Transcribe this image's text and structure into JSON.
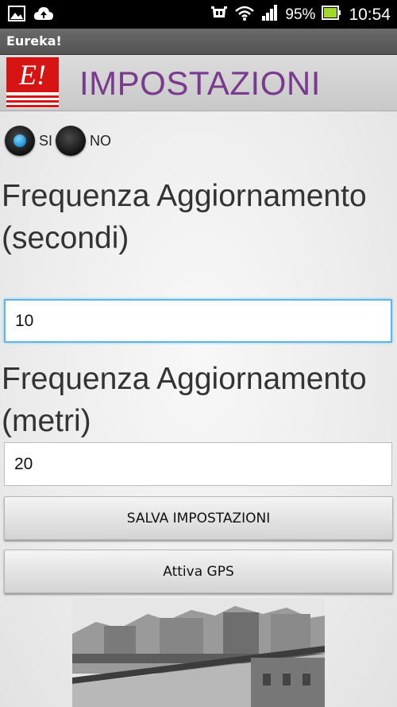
{
  "status_bar": {
    "battery_text": "95%",
    "time": "10:54",
    "icons": [
      "image-icon",
      "cloud-upload-icon",
      "android-icon",
      "wifi-icon",
      "signal-icon",
      "battery-icon"
    ]
  },
  "app": {
    "title": "Eureka!"
  },
  "header": {
    "logo_text": "E!",
    "title": "IMPOSTAZIONI"
  },
  "toggle": {
    "options": [
      {
        "label": "SI",
        "selected": true
      },
      {
        "label": "NO",
        "selected": false
      }
    ]
  },
  "frequency_seconds": {
    "label": "Frequenza Aggiornamento (secondi)",
    "value": "10"
  },
  "frequency_meters": {
    "label": "Frequenza Aggiornamento (metri)",
    "value": "20"
  },
  "buttons": {
    "save": "SALVA IMPOSTAZIONI",
    "gps": "Attiva GPS"
  },
  "colors": {
    "title_purple": "#7a3a8e",
    "logo_red": "#d61414",
    "focus_blue": "#5cb6e8",
    "radio_selected": "#1b8fd6"
  }
}
